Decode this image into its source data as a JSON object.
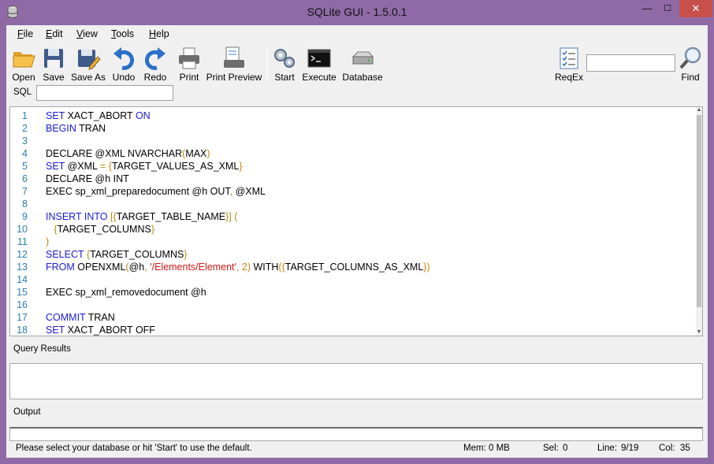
{
  "window": {
    "title": "SQLite GUI - 1.5.0.1",
    "minimize": "—",
    "maximize": "☐",
    "close": "✕"
  },
  "menu": [
    {
      "key": "F",
      "rest": "ile"
    },
    {
      "key": "E",
      "rest": "dit"
    },
    {
      "key": "V",
      "rest": "iew"
    },
    {
      "key": "T",
      "rest": "ools"
    },
    {
      "key": "H",
      "rest": "elp"
    }
  ],
  "toolbar": {
    "open": "Open",
    "save": "Save",
    "save_as": "Save As",
    "undo": "Undo",
    "redo": "Redo",
    "print": "Print",
    "print_preview": "Print Preview",
    "start": "Start",
    "execute": "Execute",
    "database": "Database",
    "regex": "ReqEx",
    "find": "Find",
    "find_value": ""
  },
  "sql": {
    "label": "SQL",
    "value": ""
  },
  "editor": {
    "lines": [
      {
        "n": "1",
        "tokens": [
          [
            "kw",
            "SET"
          ],
          [
            "t",
            " XACT_ABORT "
          ],
          [
            "kw",
            "ON"
          ]
        ]
      },
      {
        "n": "2",
        "tokens": [
          [
            "kw",
            "BEGIN"
          ],
          [
            "t",
            " TRAN"
          ]
        ]
      },
      {
        "n": "3",
        "tokens": []
      },
      {
        "n": "4",
        "tokens": [
          [
            "t",
            "DECLARE @XML NVARCHAR"
          ],
          [
            "br",
            "("
          ],
          [
            "t",
            "MAX"
          ],
          [
            "br",
            ")"
          ]
        ]
      },
      {
        "n": "5",
        "tokens": [
          [
            "kw",
            "SET"
          ],
          [
            "t",
            " @XML "
          ],
          [
            "br",
            "="
          ],
          [
            "t",
            " "
          ],
          [
            "br",
            "{"
          ],
          [
            "t",
            "TARGET_VALUES_AS_XML"
          ],
          [
            "br",
            "}"
          ]
        ]
      },
      {
        "n": "6",
        "tokens": [
          [
            "t",
            "DECLARE @h INT"
          ]
        ]
      },
      {
        "n": "7",
        "tokens": [
          [
            "t",
            "EXEC sp_xml_preparedocument @h OUT"
          ],
          [
            "br",
            ","
          ],
          [
            "t",
            " @XML"
          ]
        ]
      },
      {
        "n": "8",
        "tokens": []
      },
      {
        "n": "9",
        "tokens": [
          [
            "kw",
            "INSERT INTO"
          ],
          [
            "t",
            " "
          ],
          [
            "br",
            "[{"
          ],
          [
            "t",
            "TARGET_TABLE_NAME"
          ],
          [
            "br",
            "}]"
          ],
          [
            "t",
            " "
          ],
          [
            "br",
            "("
          ]
        ]
      },
      {
        "n": "10",
        "tokens": [
          [
            "t",
            "   "
          ],
          [
            "br",
            "{"
          ],
          [
            "t",
            "TARGET_COLUMNS"
          ],
          [
            "br",
            "}"
          ]
        ]
      },
      {
        "n": "11",
        "tokens": [
          [
            "br",
            ")"
          ]
        ]
      },
      {
        "n": "12",
        "tokens": [
          [
            "kw",
            "SELECT"
          ],
          [
            "t",
            " "
          ],
          [
            "br",
            "{"
          ],
          [
            "t",
            "TARGET_COLUMNS"
          ],
          [
            "br",
            "}"
          ]
        ]
      },
      {
        "n": "13",
        "tokens": [
          [
            "kw",
            "FROM"
          ],
          [
            "t",
            " OPENXML"
          ],
          [
            "br",
            "("
          ],
          [
            "t",
            "@h"
          ],
          [
            "br",
            ","
          ],
          [
            "t",
            " "
          ],
          [
            "str",
            "'/Elements/Element'"
          ],
          [
            "br",
            ","
          ],
          [
            "t",
            " "
          ],
          [
            "br",
            "2)"
          ],
          [
            "t",
            " WITH"
          ],
          [
            "br",
            "({"
          ],
          [
            "t",
            "TARGET_COLUMNS_AS_XML"
          ],
          [
            "br",
            "})"
          ]
        ]
      },
      {
        "n": "14",
        "tokens": []
      },
      {
        "n": "15",
        "tokens": [
          [
            "t",
            "EXEC sp_xml_removedocument @h"
          ]
        ]
      },
      {
        "n": "16",
        "tokens": []
      },
      {
        "n": "17",
        "tokens": [
          [
            "kw",
            "COMMIT"
          ],
          [
            "t",
            " TRAN"
          ]
        ]
      },
      {
        "n": "18",
        "tokens": [
          [
            "kw",
            "SET"
          ],
          [
            "t",
            " XACT_ABORT OFF"
          ]
        ]
      }
    ]
  },
  "query_results": {
    "label": "Query Results"
  },
  "output": {
    "label": "Output"
  },
  "status": {
    "message": "Please select your database or hit 'Start' to use the default.",
    "mem_label": "Mem:",
    "mem_value": "0 MB",
    "sel_label": "Sel:",
    "sel_value": "0",
    "line_label": "Line:",
    "line_value": "9/19",
    "col_label": "Col:",
    "col_value": "35"
  }
}
